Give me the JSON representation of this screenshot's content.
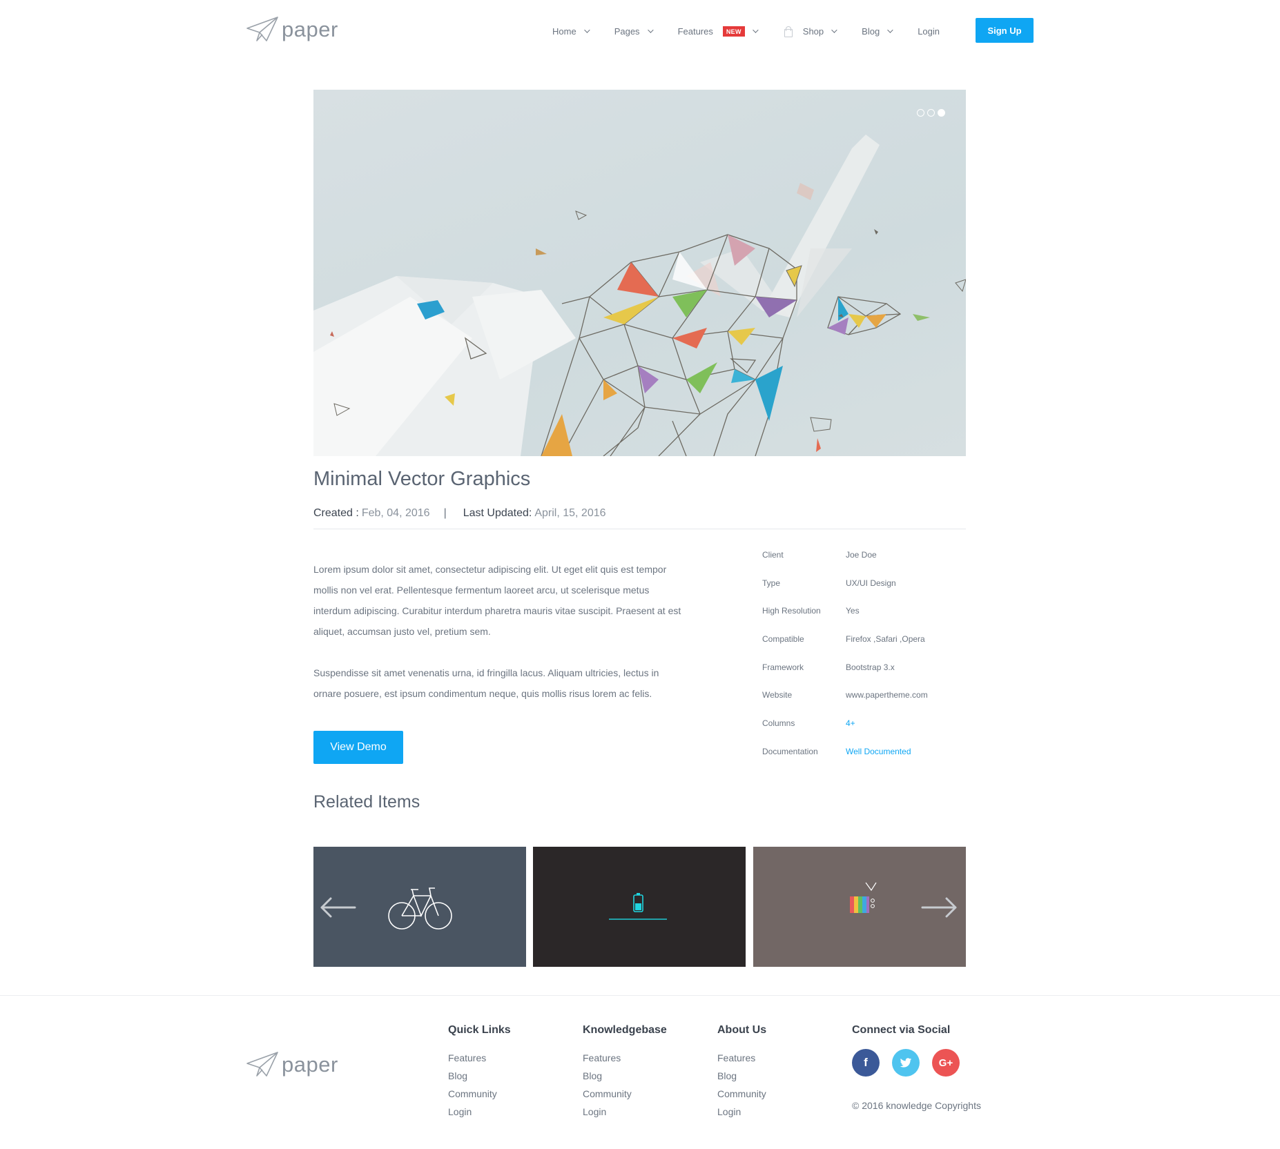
{
  "brand": {
    "name": "paper"
  },
  "nav": {
    "items": [
      {
        "label": "Home"
      },
      {
        "label": "Pages"
      },
      {
        "label": "Features",
        "badge": "NEW"
      },
      {
        "label": "Shop"
      },
      {
        "label": "Blog"
      },
      {
        "label": "Login"
      }
    ],
    "signup_label": "Sign Up"
  },
  "slider": {
    "slide_count": 3,
    "active_slide": 3
  },
  "project": {
    "title": "Minimal Vector Graphics",
    "created_label": "Created :",
    "created_value": "Feb, 04, 2016",
    "separator": "|",
    "updated_label": "Last Updated:",
    "updated_value": "April, 15, 2016",
    "paragraphs": [
      "Lorem ipsum dolor sit amet, consectetur adipiscing elit. Ut eget elit quis est tempor mollis non vel erat. Pellentesque fermentum laoreet arcu, ut scelerisque metus interdum adipiscing. Curabitur interdum pharetra mauris vitae suscipit. Praesent at est aliquet, accumsan justo vel, pretium sem.",
      "Suspendisse sit amet venenatis urna, id fringilla lacus. Aliquam ultricies, lectus in ornare posuere, est ipsum condimentum neque, quis mollis risus lorem ac felis."
    ],
    "view_demo_label": "View Demo",
    "specs": [
      {
        "label": "Client",
        "value": "Joe Doe"
      },
      {
        "label": "Type",
        "value": "UX/UI Design"
      },
      {
        "label": "High Resolution",
        "value": "Yes"
      },
      {
        "label": "Compatible",
        "value": "Firefox ,Safari ,Opera"
      },
      {
        "label": "Framework",
        "value": "Bootstrap 3.x"
      },
      {
        "label": "Website",
        "value": "www.papertheme.com"
      },
      {
        "label": "Columns",
        "value": "4+"
      },
      {
        "label": "Documentation",
        "value": "Well Documented"
      }
    ]
  },
  "related": {
    "title": "Related Items",
    "colors": [
      "#4a5562",
      "#2b2728",
      "#726765"
    ]
  },
  "footer": {
    "columns": [
      {
        "title": "Quick Links",
        "links": [
          "Features",
          "Blog",
          "Community",
          "Login"
        ]
      },
      {
        "title": "Knowledgebase",
        "links": [
          "Features",
          "Blog",
          "Community",
          "Login"
        ]
      },
      {
        "title": "About Us",
        "links": [
          "Features",
          "Blog",
          "Community",
          "Login"
        ]
      }
    ],
    "social_title": "Connect via Social",
    "social": [
      {
        "icon": "facebook-icon",
        "glyph": "f",
        "color": "#3b5998"
      },
      {
        "icon": "twitter-icon",
        "color": "#4fc4ef"
      },
      {
        "icon": "google-plus-icon",
        "glyph": "G+",
        "color": "#ec5454"
      }
    ],
    "copyright": "© 2016 knowledge Copyrights"
  },
  "colors": {
    "accent": "#0fa6f3",
    "badge": "#e53a3a"
  }
}
